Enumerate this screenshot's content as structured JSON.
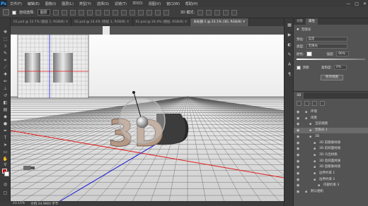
{
  "app": {
    "logo": "Ps",
    "menus": [
      "文件(F)",
      "编辑(E)",
      "图像(I)",
      "图层(L)",
      "类型(Y)",
      "选择(S)",
      "滤镜(T)",
      "3D(D)",
      "视图(V)",
      "窗口(W)",
      "帮助(H)"
    ],
    "window_controls": [
      "—",
      "□",
      "✕"
    ]
  },
  "options_bar": {
    "auto_select_label": "自动选择:",
    "auto_select_value": "图层",
    "mode_label": "3D 模式:"
  },
  "doc_tabs": [
    {
      "label": "01.psd @ 33.7% (图层 1, RGB/8) ✕",
      "active": false
    },
    {
      "label": "02.psd @ 24.4% (图层 1, RGB/8) ✕",
      "active": false
    },
    {
      "label": "01.psd @ 24.4% (图层, RGB/8) ✕",
      "active": false
    },
    {
      "label": "未标题-1 @ 23.1% (3D, RGB/8) ✕",
      "active": true
    }
  ],
  "canvas": {
    "text_3d": "3D"
  },
  "status_bar": {
    "zoom": "23.11%",
    "doc_info": "文档:24.9M/0 字节"
  },
  "properties": {
    "tabs": [
      "调整",
      "属性"
    ],
    "light_type_label": "无限光",
    "preset_label": "预设:",
    "preset_value": "自定",
    "type_label": "类型:",
    "type_value": "无限光",
    "color_label": "颜色:",
    "intensity_label": "强度:",
    "intensity_value": "90%",
    "shadow_label": "阴影",
    "softness_label": "柔和度:",
    "softness_value": "0%",
    "move_to_view_button": "移到视图"
  },
  "panel3d": {
    "tab": "3D",
    "tree": [
      {
        "label": "环境",
        "indent": 0,
        "selected": false
      },
      {
        "label": "场景",
        "indent": 0,
        "selected": false
      },
      {
        "label": "当前视图",
        "indent": 1,
        "selected": false
      },
      {
        "label": "无限光 1",
        "indent": 1,
        "selected": true
      },
      {
        "label": "3D",
        "indent": 1,
        "selected": false
      },
      {
        "label": "3D 前膨胀材质",
        "indent": 2,
        "selected": false
      },
      {
        "label": "3D 前斜面材质",
        "indent": 2,
        "selected": false
      },
      {
        "label": "3D 凸出材质",
        "indent": 2,
        "selected": false
      },
      {
        "label": "3D 后斜面材质",
        "indent": 2,
        "selected": false
      },
      {
        "label": "3D 后膨胀材质",
        "indent": 2,
        "selected": false
      },
      {
        "label": "边界约束 1",
        "indent": 2,
        "selected": false
      },
      {
        "label": "边界约束 2",
        "indent": 2,
        "selected": false
      },
      {
        "label": "内部约束 3",
        "indent": 3,
        "selected": false
      },
      {
        "label": "默认相机",
        "indent": 0,
        "selected": false
      }
    ]
  },
  "colors": {
    "foreground": "#c81414",
    "background": "#ffffff",
    "ui_dark": "#3a3a3a",
    "ui_mid": "#535353"
  }
}
